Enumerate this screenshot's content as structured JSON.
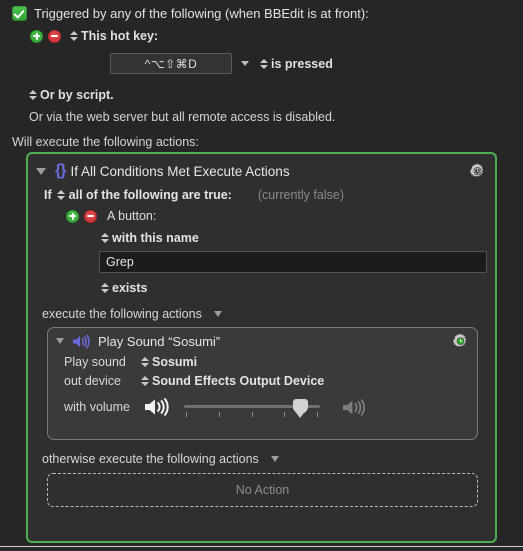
{
  "trigger": {
    "enabled_checkbox": "checked",
    "title": "Triggered by any of the following (when BBEdit is at front):",
    "hotkey_label": "This hot key:",
    "hotkey_value": "^⌥⇧⌘D",
    "hotkey_condition": "is pressed",
    "script_label": "Or by script.",
    "webserver_note": "Or via the web server but all remote access is disabled."
  },
  "actions_intro": "Will execute the following actions:",
  "if_action": {
    "title": "If All Conditions Met Execute Actions",
    "icon": "braces-icon",
    "gear_icon": "gear-clock-icon",
    "condition_prefix": "If",
    "condition_mode": "all of the following are true:",
    "condition_status": "(currently false)",
    "condition_item": {
      "type": "A button:",
      "qualifier": "with this name",
      "name_value": "Grep",
      "operator": "exists"
    },
    "execute_label": "execute the following actions",
    "otherwise_label": "otherwise execute the following actions",
    "no_action_label": "No Action",
    "border_color": "#4caf50"
  },
  "play_sound": {
    "title": "Play Sound “Sosumi”",
    "icon": "speaker-icon",
    "gear_icon": "gear-green-icon",
    "fields": [
      {
        "caption": "Play sound",
        "value": "Sosumi"
      },
      {
        "caption": "out device",
        "value": "Sound Effects Output Device"
      }
    ],
    "volume": {
      "caption": "with volume",
      "percent": 85,
      "low_icon": "speaker-low-icon",
      "high_icon": "speaker-high-icon"
    }
  },
  "colors": {
    "accent_green": "#4caf50",
    "icon_blue": "#6b6be0",
    "plus_green": "#3aa83a",
    "minus_red": "#d04040",
    "background": "#262626"
  }
}
